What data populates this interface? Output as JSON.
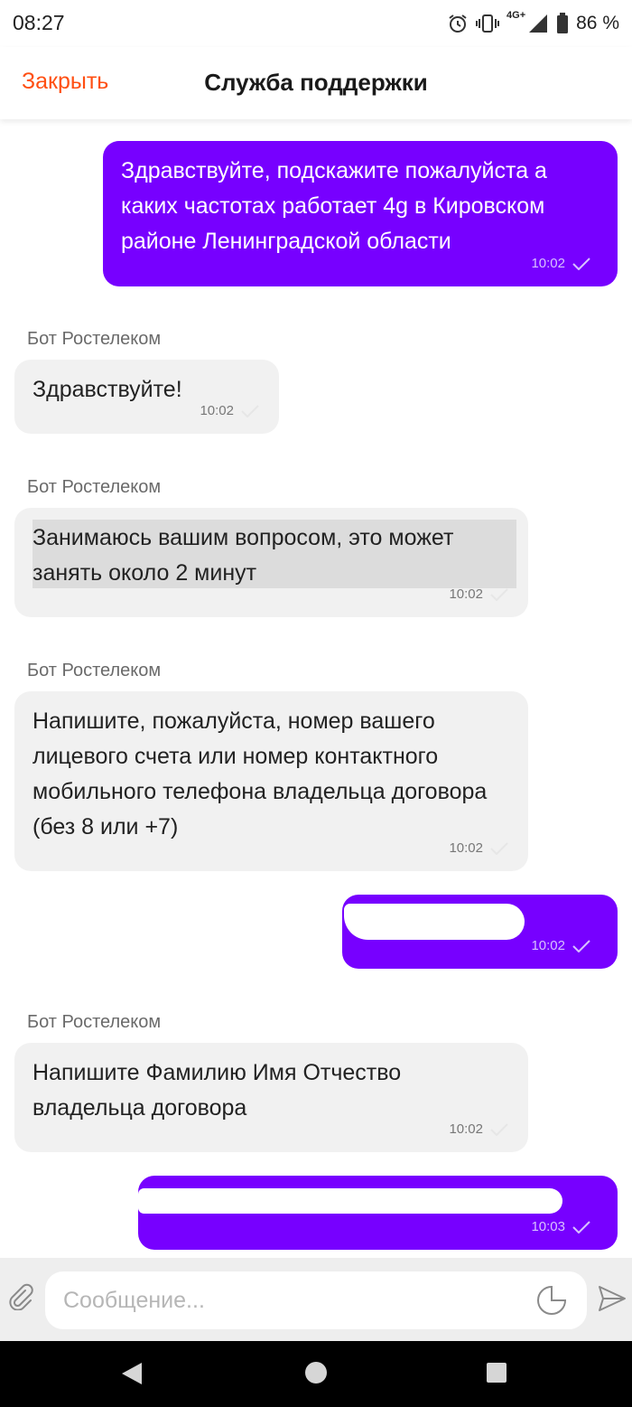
{
  "status_bar": {
    "time": "08:27",
    "network": "4G+",
    "battery": "86 %",
    "icons": [
      "alarm-icon",
      "vibrate-icon",
      "signal-icon",
      "battery-icon"
    ]
  },
  "header": {
    "close_label": "Закрыть",
    "title": "Служба поддержки"
  },
  "colors": {
    "accent": "#ff4f12",
    "outgoing_bubble": "#7700ff",
    "incoming_bubble": "#f1f1f1"
  },
  "messages": [
    {
      "direction": "out",
      "text": "Здравствуйте, подскажите пожалуйста а каких частотах работает 4g в Кировском районе Ленинградской области",
      "time": "10:02"
    },
    {
      "direction": "in",
      "sender": "Бот Ростелеком",
      "text": "Здравствуйте!",
      "time": "10:02"
    },
    {
      "direction": "in",
      "sender": "Бот Ростелеком",
      "text": "Занимаюсь вашим вопросом, это может занять около 2 минут",
      "time": "10:02"
    },
    {
      "direction": "in",
      "sender": "Бот Ростелеком",
      "text": "Напишите, пожалуйста, номер вашего лицевого счета или номер контактного мобильного телефона владельца договора (без 8 или +7)",
      "time": "10:02"
    },
    {
      "direction": "out",
      "text": "",
      "time": "10:02",
      "redacted": true
    },
    {
      "direction": "in",
      "sender": "Бот Ростелеком",
      "text": "Напишите Фамилию Имя Отчество владельца договора",
      "time": "10:02"
    },
    {
      "direction": "out",
      "text": "",
      "time": "10:03",
      "redacted": true
    }
  ],
  "input": {
    "placeholder": "Сообщение..."
  }
}
